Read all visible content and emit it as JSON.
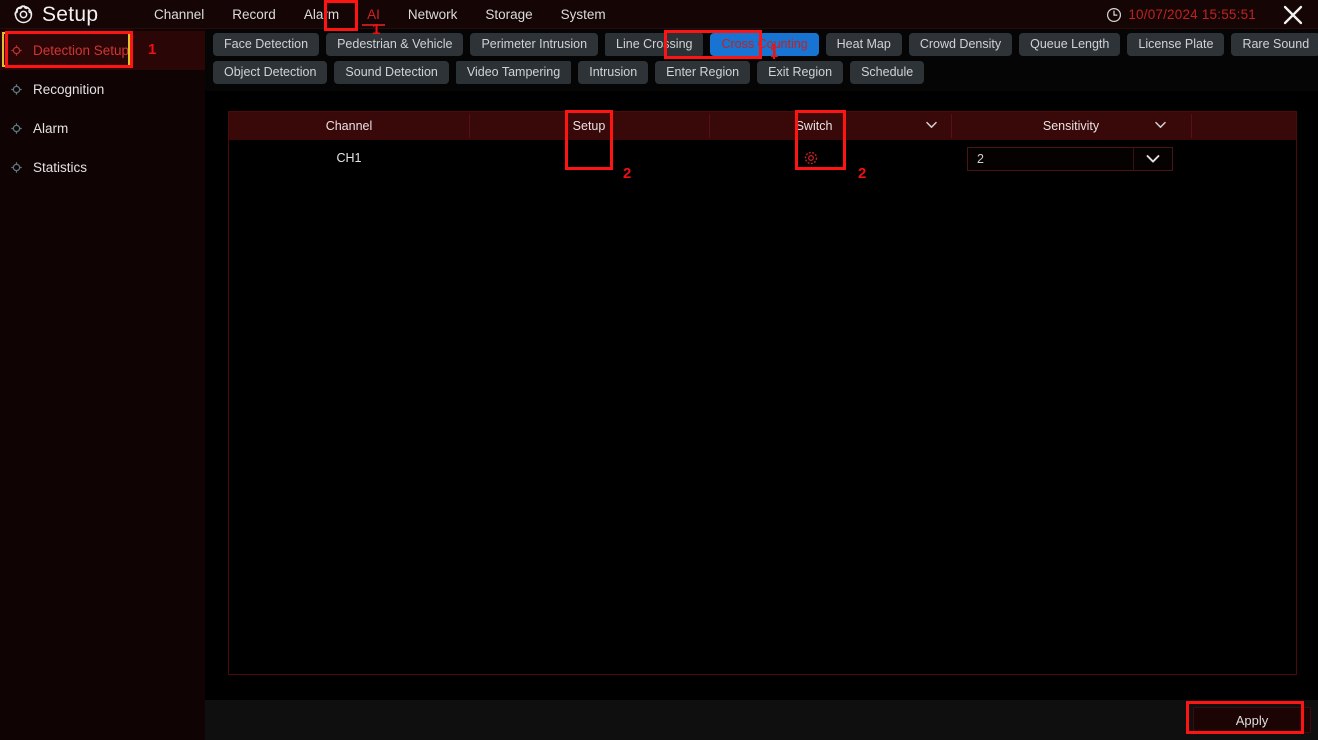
{
  "header": {
    "logo_icon": "gear-icon",
    "title": "Setup",
    "menu": [
      {
        "label": "Channel",
        "active": false
      },
      {
        "label": "Record",
        "active": false
      },
      {
        "label": "Alarm",
        "active": false
      },
      {
        "label": "AI",
        "active": true
      },
      {
        "label": "Network",
        "active": false
      },
      {
        "label": "Storage",
        "active": false
      },
      {
        "label": "System",
        "active": false
      }
    ],
    "clock_icon": "clock-icon",
    "datetime": "10/07/2024 15:55:51",
    "close_icon": "close-icon"
  },
  "sidebar": {
    "items": [
      {
        "label": "Detection Setup",
        "icon": "target-icon",
        "selected": true
      },
      {
        "label": "Recognition",
        "icon": "target-icon",
        "selected": false
      },
      {
        "label": "Alarm",
        "icon": "target-icon",
        "selected": false
      },
      {
        "label": "Statistics",
        "icon": "target-icon",
        "selected": false
      }
    ]
  },
  "tabs": {
    "row1": [
      {
        "label": "Face Detection",
        "active": false
      },
      {
        "label": "Pedestrian & Vehicle",
        "active": false
      },
      {
        "label": "Perimeter Intrusion",
        "active": false
      },
      {
        "label": "Line Crossing",
        "active": false
      },
      {
        "label": "Cross Counting",
        "active": true
      },
      {
        "label": "Heat Map",
        "active": false
      },
      {
        "label": "Crowd Density",
        "active": false
      },
      {
        "label": "Queue Length",
        "active": false
      },
      {
        "label": "License Plate",
        "active": false
      },
      {
        "label": "Rare Sound",
        "active": false
      }
    ],
    "row2": [
      {
        "label": "Object Detection",
        "active": false
      },
      {
        "label": "Sound Detection",
        "active": false
      },
      {
        "label": "Video Tampering",
        "active": false
      },
      {
        "label": "Intrusion",
        "active": false
      },
      {
        "label": "Enter Region",
        "active": false
      },
      {
        "label": "Exit Region",
        "active": false
      },
      {
        "label": "Schedule",
        "active": false
      }
    ]
  },
  "table": {
    "headers": {
      "channel": "Channel",
      "setup": "Setup",
      "switch": "Switch",
      "sensitivity": "Sensitivity"
    },
    "header_chevron_icon": "chevron-down-icon",
    "rows": [
      {
        "channel": "CH1",
        "setup_icon": "gear-icon",
        "switch_checked": true,
        "sensitivity_value": "2",
        "sensitivity_chevron_icon": "chevron-down-icon"
      }
    ]
  },
  "footer": {
    "apply_label": "Apply"
  },
  "annotations": {
    "step1_ai": "1",
    "step1_sidebar": "1",
    "step1_tab": "1",
    "step2_setup": "2",
    "step2_switch": "2",
    "accent_red": "#ff1414",
    "accent_blue": "#1874d2",
    "accent_yellow": "#d8c82a"
  }
}
